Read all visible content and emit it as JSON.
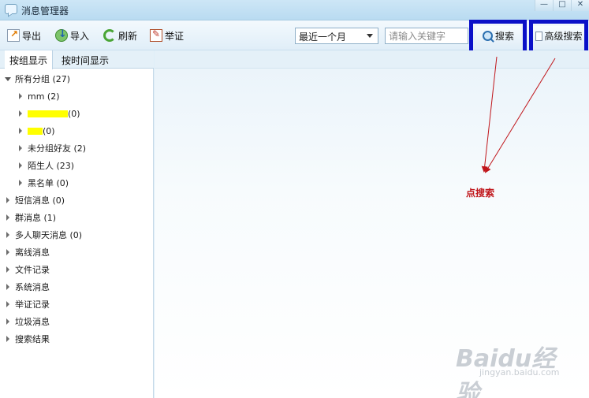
{
  "window": {
    "title": "消息管理器",
    "controls": [
      "—",
      "□",
      "✕"
    ]
  },
  "toolbar": {
    "export_label": "导出",
    "import_label": "导入",
    "refresh_label": "刷新",
    "report_label": "举证",
    "range_value": "最近一个月",
    "search_placeholder": "请输入关键字",
    "search_label": "搜索",
    "advanced_search_label": "高级搜索"
  },
  "tabs": [
    "按组显示",
    "按时间显示"
  ],
  "tree": {
    "all_groups": "所有分组 (27)",
    "groups": [
      {
        "label": "mm (2)"
      },
      {
        "label": "(0)"
      },
      {
        "label": "(0)"
      },
      {
        "label": "未分组好友 (2)"
      },
      {
        "label": "陌生人 (23)"
      },
      {
        "label": "黑名单 (0)"
      }
    ],
    "categories": [
      "短信消息 (0)",
      "群消息 (1)",
      "多人聊天消息 (0)",
      "离线消息",
      "文件记录",
      "系统消息",
      "举证记录",
      "垃圾消息",
      "搜索结果"
    ]
  },
  "annotation": {
    "note": "点搜索",
    "color": "#c0151a",
    "box_color": "#0a10c8"
  },
  "watermark": {
    "logo": "Baidu经验",
    "url": "jingyan.baidu.com"
  }
}
